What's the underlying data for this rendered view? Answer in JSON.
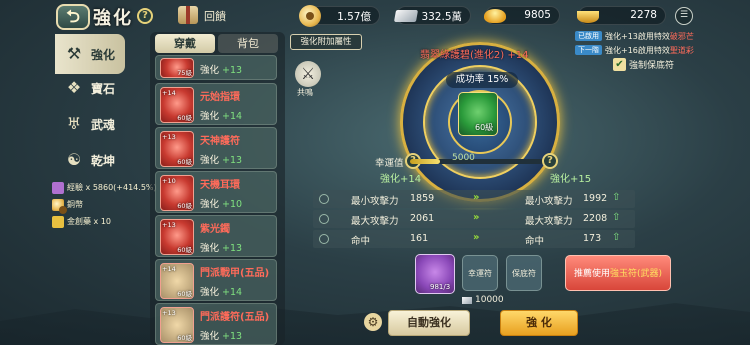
{
  "header": {
    "back": "⮌",
    "title": "強化",
    "help": "?"
  },
  "gift": {
    "label": "回饋"
  },
  "currencies": [
    {
      "name": "coins",
      "value": "1.57億"
    },
    {
      "name": "silver",
      "value": "332.5萬"
    },
    {
      "name": "ingot",
      "value": "9805"
    },
    {
      "name": "gold",
      "value": "2278"
    }
  ],
  "sidebar": {
    "tabs": [
      {
        "label": "強化",
        "icon": "hammer-icon"
      },
      {
        "label": "寶石",
        "icon": "gem-icon"
      },
      {
        "label": "武魂",
        "icon": "soul-icon"
      },
      {
        "label": "乾坤",
        "icon": "yin-yang-icon"
      }
    ],
    "exp": [
      {
        "text": "經驗 x 5860(+414.5%)"
      },
      {
        "text": "銅幣"
      },
      {
        "text": "金創藥 x 10"
      }
    ]
  },
  "equip": {
    "tabs": [
      "穿戴",
      "背包"
    ],
    "items": [
      {
        "name": "",
        "stat_label": "強化",
        "stat_val": "+13",
        "lvl": "75級",
        "plus": ""
      },
      {
        "name": "元始指環",
        "stat_label": "強化",
        "stat_val": "+14",
        "lvl": "60級",
        "plus": "+14"
      },
      {
        "name": "天神護符",
        "stat_label": "強化",
        "stat_val": "+13",
        "lvl": "60級",
        "plus": "+13"
      },
      {
        "name": "天機耳環",
        "stat_label": "強化",
        "stat_val": "+10",
        "lvl": "60級",
        "plus": "+10"
      },
      {
        "name": "紫光鐲",
        "stat_label": "強化",
        "stat_val": "+13",
        "lvl": "60級",
        "plus": "+13"
      },
      {
        "name": "門派戰甲(五品)",
        "stat_label": "強化",
        "stat_val": "+14",
        "lvl": "60級",
        "plus": "+14"
      },
      {
        "name": "門派護符(五品)",
        "stat_label": "強化",
        "stat_val": "+13",
        "lvl": "60級",
        "plus": "+13"
      }
    ]
  },
  "center": {
    "attr_button": "強化附加屬性",
    "resonance": "共鳴",
    "equip_title": "翡翠綠護",
    "equip_title_suffix": "碧(進化2) +14",
    "success": "成功率 15%",
    "item_lvl": "60級",
    "luck_label": "幸運值",
    "luck_value": "5000",
    "luck_fraction": 0.22,
    "cur_level": "強化+14",
    "next_level": "強化+15"
  },
  "stats": [
    {
      "label": "最小攻擊力",
      "cur": "1859",
      "label2": "最小攻擊力",
      "next": "1992"
    },
    {
      "label": "最大攻擊力",
      "cur": "2061",
      "label2": "最大攻擊力",
      "next": "2208"
    },
    {
      "label": "命中",
      "cur": "161",
      "label2": "命中",
      "next": "173"
    }
  ],
  "bonus": [
    {
      "tag": "已啟用",
      "text": "強化+13啟用特效",
      "red": "破邪芒"
    },
    {
      "tag": "下一階",
      "text": "強化+16啟用特效",
      "red": "聖道彩"
    }
  ],
  "force": {
    "label": "強制保底符"
  },
  "materials": {
    "count": "981/3",
    "slot1": "幸運符",
    "slot2": "保底符",
    "cost": "10000",
    "recommend": "推薦使用",
    "recommend_item": "強玉符(武器)"
  },
  "buttons": {
    "auto": "自動強化",
    "enhance": "強 化"
  }
}
